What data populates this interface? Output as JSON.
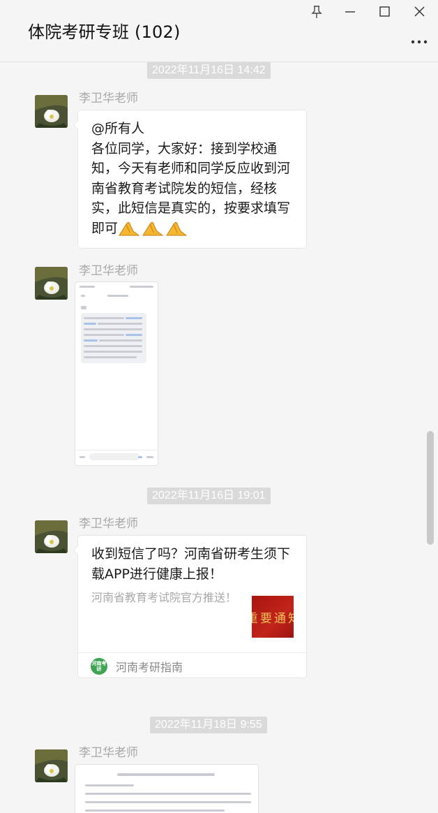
{
  "window": {
    "title": "体院考研专班 (102)",
    "controls": [
      "pin-icon",
      "minimize-icon",
      "maximize-icon",
      "close-icon"
    ]
  },
  "colors": {
    "background": "#f5f5f5",
    "bubble": "#ffffff",
    "timestamp_bg": "#dadada",
    "sender_name": "#a8a8a8",
    "source_logo": "#3ea453"
  },
  "messages": [
    {
      "timestamp": "2022年11月16日 14:42",
      "sender": "李卫华老师",
      "type": "text",
      "mention": "@所有人",
      "text": "各位同学，大家好：接到学校通知，今天有老师和同学反应收到河南省教育考试院发的短信，经核实，此短信是真实的，按要求填写即可",
      "emoji": [
        "folded-hands-emoji",
        "folded-hands-emoji",
        "folded-hands-emoji"
      ]
    },
    {
      "sender": "李卫华老师",
      "type": "image",
      "image_desc": "screenshot-thumbnail"
    },
    {
      "timestamp": "2022年11月16日 19:01",
      "sender": "李卫华老师",
      "type": "link-card",
      "card_title": "收到短信了吗？河南省研考生须下载APP进行健康上报！",
      "card_desc": "河南省教育考试院官方推送！",
      "thumb_text": "重要通知",
      "source_logo_text": "河南考研",
      "source_name": "河南考研指南"
    },
    {
      "timestamp": "2022年11月18日 9:55",
      "sender": "李卫华老师",
      "type": "image",
      "image_desc": "document-thumbnail"
    }
  ]
}
